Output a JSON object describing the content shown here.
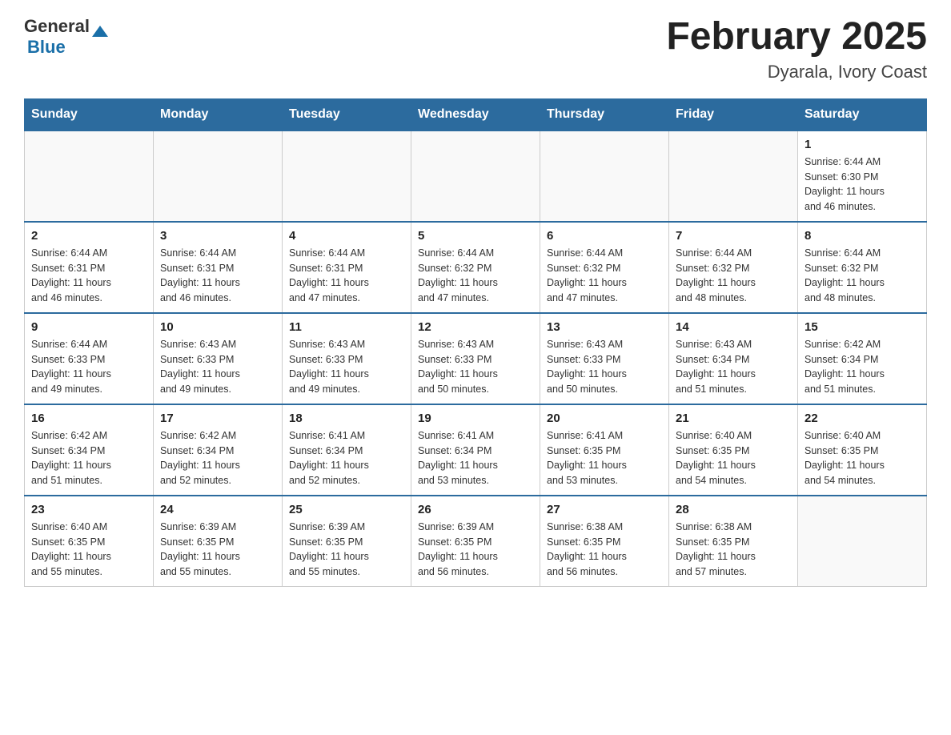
{
  "header": {
    "logo_general": "General",
    "logo_blue": "Blue",
    "title": "February 2025",
    "subtitle": "Dyarala, Ivory Coast"
  },
  "weekdays": [
    "Sunday",
    "Monday",
    "Tuesday",
    "Wednesday",
    "Thursday",
    "Friday",
    "Saturday"
  ],
  "weeks": [
    [
      {
        "day": "",
        "info": ""
      },
      {
        "day": "",
        "info": ""
      },
      {
        "day": "",
        "info": ""
      },
      {
        "day": "",
        "info": ""
      },
      {
        "day": "",
        "info": ""
      },
      {
        "day": "",
        "info": ""
      },
      {
        "day": "1",
        "info": "Sunrise: 6:44 AM\nSunset: 6:30 PM\nDaylight: 11 hours\nand 46 minutes."
      }
    ],
    [
      {
        "day": "2",
        "info": "Sunrise: 6:44 AM\nSunset: 6:31 PM\nDaylight: 11 hours\nand 46 minutes."
      },
      {
        "day": "3",
        "info": "Sunrise: 6:44 AM\nSunset: 6:31 PM\nDaylight: 11 hours\nand 46 minutes."
      },
      {
        "day": "4",
        "info": "Sunrise: 6:44 AM\nSunset: 6:31 PM\nDaylight: 11 hours\nand 47 minutes."
      },
      {
        "day": "5",
        "info": "Sunrise: 6:44 AM\nSunset: 6:32 PM\nDaylight: 11 hours\nand 47 minutes."
      },
      {
        "day": "6",
        "info": "Sunrise: 6:44 AM\nSunset: 6:32 PM\nDaylight: 11 hours\nand 47 minutes."
      },
      {
        "day": "7",
        "info": "Sunrise: 6:44 AM\nSunset: 6:32 PM\nDaylight: 11 hours\nand 48 minutes."
      },
      {
        "day": "8",
        "info": "Sunrise: 6:44 AM\nSunset: 6:32 PM\nDaylight: 11 hours\nand 48 minutes."
      }
    ],
    [
      {
        "day": "9",
        "info": "Sunrise: 6:44 AM\nSunset: 6:33 PM\nDaylight: 11 hours\nand 49 minutes."
      },
      {
        "day": "10",
        "info": "Sunrise: 6:43 AM\nSunset: 6:33 PM\nDaylight: 11 hours\nand 49 minutes."
      },
      {
        "day": "11",
        "info": "Sunrise: 6:43 AM\nSunset: 6:33 PM\nDaylight: 11 hours\nand 49 minutes."
      },
      {
        "day": "12",
        "info": "Sunrise: 6:43 AM\nSunset: 6:33 PM\nDaylight: 11 hours\nand 50 minutes."
      },
      {
        "day": "13",
        "info": "Sunrise: 6:43 AM\nSunset: 6:33 PM\nDaylight: 11 hours\nand 50 minutes."
      },
      {
        "day": "14",
        "info": "Sunrise: 6:43 AM\nSunset: 6:34 PM\nDaylight: 11 hours\nand 51 minutes."
      },
      {
        "day": "15",
        "info": "Sunrise: 6:42 AM\nSunset: 6:34 PM\nDaylight: 11 hours\nand 51 minutes."
      }
    ],
    [
      {
        "day": "16",
        "info": "Sunrise: 6:42 AM\nSunset: 6:34 PM\nDaylight: 11 hours\nand 51 minutes."
      },
      {
        "day": "17",
        "info": "Sunrise: 6:42 AM\nSunset: 6:34 PM\nDaylight: 11 hours\nand 52 minutes."
      },
      {
        "day": "18",
        "info": "Sunrise: 6:41 AM\nSunset: 6:34 PM\nDaylight: 11 hours\nand 52 minutes."
      },
      {
        "day": "19",
        "info": "Sunrise: 6:41 AM\nSunset: 6:34 PM\nDaylight: 11 hours\nand 53 minutes."
      },
      {
        "day": "20",
        "info": "Sunrise: 6:41 AM\nSunset: 6:35 PM\nDaylight: 11 hours\nand 53 minutes."
      },
      {
        "day": "21",
        "info": "Sunrise: 6:40 AM\nSunset: 6:35 PM\nDaylight: 11 hours\nand 54 minutes."
      },
      {
        "day": "22",
        "info": "Sunrise: 6:40 AM\nSunset: 6:35 PM\nDaylight: 11 hours\nand 54 minutes."
      }
    ],
    [
      {
        "day": "23",
        "info": "Sunrise: 6:40 AM\nSunset: 6:35 PM\nDaylight: 11 hours\nand 55 minutes."
      },
      {
        "day": "24",
        "info": "Sunrise: 6:39 AM\nSunset: 6:35 PM\nDaylight: 11 hours\nand 55 minutes."
      },
      {
        "day": "25",
        "info": "Sunrise: 6:39 AM\nSunset: 6:35 PM\nDaylight: 11 hours\nand 55 minutes."
      },
      {
        "day": "26",
        "info": "Sunrise: 6:39 AM\nSunset: 6:35 PM\nDaylight: 11 hours\nand 56 minutes."
      },
      {
        "day": "27",
        "info": "Sunrise: 6:38 AM\nSunset: 6:35 PM\nDaylight: 11 hours\nand 56 minutes."
      },
      {
        "day": "28",
        "info": "Sunrise: 6:38 AM\nSunset: 6:35 PM\nDaylight: 11 hours\nand 57 minutes."
      },
      {
        "day": "",
        "info": ""
      }
    ]
  ]
}
